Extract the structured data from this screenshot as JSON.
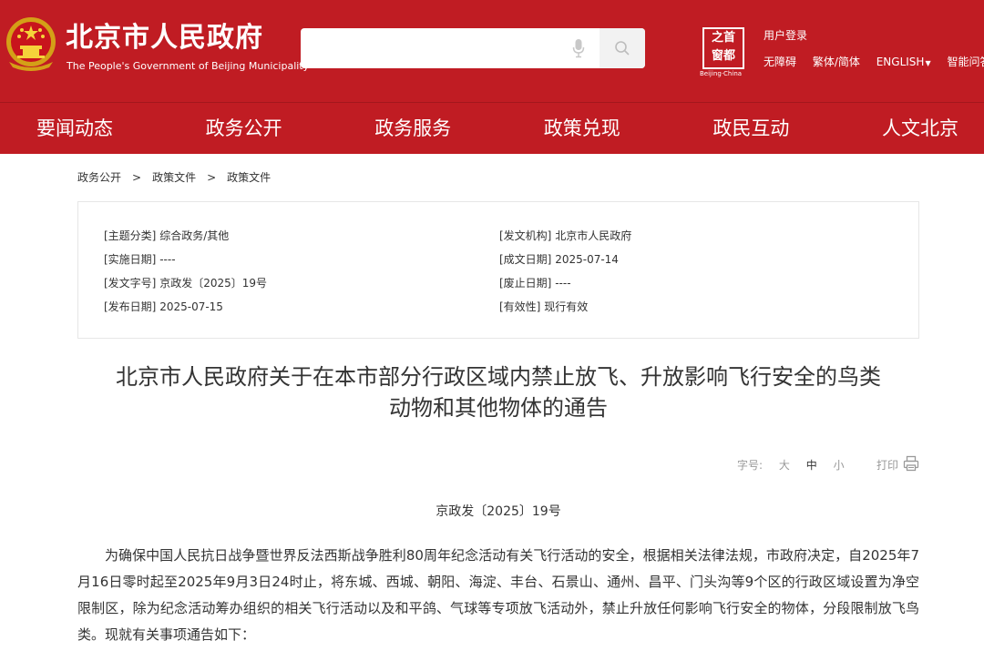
{
  "header": {
    "site_title_cn": "北京市人民政府",
    "site_title_en": "The People's Government of Beijing Municipality",
    "search_placeholder": "",
    "seal_chars": [
      "首",
      "都",
      "之",
      "窗"
    ],
    "seal_subtitle": "Beijing·China",
    "login": "用户登录",
    "tools": {
      "accessibility": "无障碍",
      "script_toggle": "繁体/简体",
      "english": "ENGLISH",
      "smart_qa": "智能问答"
    },
    "colors": {
      "brand_red": "#c01c23"
    }
  },
  "nav": {
    "items": [
      "要闻动态",
      "政务公开",
      "政务服务",
      "政策兑现",
      "政民互动",
      "人文北京"
    ]
  },
  "breadcrumb": {
    "items": [
      "政务公开",
      "政策文件",
      "政策文件"
    ],
    "separator": ">"
  },
  "info": {
    "left": [
      {
        "label": "[主题分类]",
        "value": "综合政务/其他"
      },
      {
        "label": "[实施日期]",
        "value": "----"
      },
      {
        "label": "[发文字号]",
        "value": "京政发〔2025〕19号"
      },
      {
        "label": "[发布日期]",
        "value": "2025-07-15"
      }
    ],
    "right": [
      {
        "label": "[发文机构]",
        "value": "北京市人民政府"
      },
      {
        "label": "[成文日期]",
        "value": "2025-07-14"
      },
      {
        "label": "[废止日期]",
        "value": "----"
      },
      {
        "label": "[有效性]",
        "value": "现行有效"
      }
    ]
  },
  "article": {
    "title_line1": "北京市人民政府关于在本市部分行政区域内禁止放飞、升放影响飞行安全的鸟类",
    "title_line2": "动物和其他物体的通告",
    "font_size_label": "字号:",
    "font_sizes": [
      "大",
      "中",
      "小"
    ],
    "print_label": "打印",
    "doc_number": "京政发〔2025〕19号",
    "body": "为确保中国人民抗日战争暨世界反法西斯战争胜利80周年纪念活动有关飞行活动的安全，根据相关法律法规，市政府决定，自2025年7月16日零时起至2025年9月3日24时止，将东城、西城、朝阳、海淀、丰台、石景山、通州、昌平、门头沟等9个区的行政区域设置为净空限制区，除为纪念活动筹办组织的相关飞行活动以及和平鸽、气球等专项放飞活动外，禁止升放任何影响飞行安全的物体，分段限制放飞鸟类。现就有关事项通告如下："
  }
}
